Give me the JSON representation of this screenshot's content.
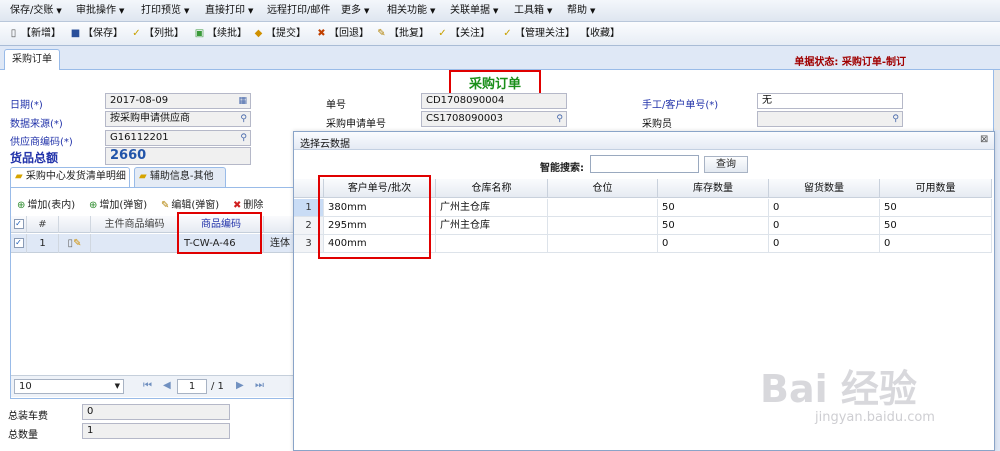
{
  "menu": [
    {
      "label": "保存/交账"
    },
    {
      "label": "审批操作"
    },
    {
      "label": "打印预览"
    },
    {
      "label": "直接打印"
    },
    {
      "label": "远程打印/邮件"
    },
    {
      "label": "更多"
    },
    {
      "label": "相关功能"
    },
    {
      "label": "关联单据"
    },
    {
      "label": "工具箱"
    },
    {
      "label": "帮助"
    }
  ],
  "toolbar": [
    {
      "label": "【新增】",
      "icon": "doc-new-icon"
    },
    {
      "label": "【保存】",
      "icon": "save-icon"
    },
    {
      "label": "【列批】",
      "icon": "check-icon"
    },
    {
      "label": "【续批】",
      "icon": "continue-icon"
    },
    {
      "label": "【提交】",
      "icon": "submit-icon"
    },
    {
      "label": "【回退】",
      "icon": "rollback-icon"
    },
    {
      "label": "【批复】",
      "icon": "reply-icon"
    },
    {
      "label": "【关注】",
      "icon": "follow-icon"
    },
    {
      "label": "【管理关注】",
      "icon": "manage-follow-icon"
    },
    {
      "label": "【收藏】",
      "icon": ""
    }
  ],
  "tab": {
    "label": "采购订单"
  },
  "status": {
    "text": "单据状态:  采购订单-制订"
  },
  "form": {
    "title": "采购订单",
    "date_label": "日期(*)",
    "date_value": "2017-08-09",
    "no_label": "单号",
    "no_value": "CD1708090004",
    "manual_label": "手工/客户单号(*)",
    "manual_value": "无",
    "source_label": "数据来源(*)",
    "source_value": "按采购申请供应商",
    "req_label": "采购申请单号",
    "req_value": "CS1708090003",
    "buyer_label": "采购员",
    "buyer_value": "",
    "supplier_label": "供应商编码(*)",
    "supplier_value": "G16112201",
    "total_label": "货品总额",
    "total_value": "2660"
  },
  "subtabs": [
    {
      "label": "采购中心发货清单明细"
    },
    {
      "label": "辅助信息-其他"
    }
  ],
  "subtoolbar": [
    {
      "label": "增加(表内)"
    },
    {
      "label": "增加(弹窗)"
    },
    {
      "label": "编辑(弹窗)"
    },
    {
      "label": "删除"
    }
  ],
  "grid": {
    "headers": {
      "num": "#",
      "main_code": "主件商品编码",
      "code": "商品编码"
    },
    "row": {
      "index": "1",
      "code": "T-CW-A-46",
      "name": "连体"
    }
  },
  "pager": {
    "size": "10",
    "page": "1",
    "of": "/ 1"
  },
  "summary": {
    "freight_label": "总装车费",
    "freight_value": "0",
    "qty_label": "总数量",
    "qty_value": "1"
  },
  "popup": {
    "title": "选择云数据",
    "smart_label": "智能搜索:",
    "query_label": "查询",
    "headers": [
      "客户单号/批次",
      "仓库名称",
      "仓位",
      "库存数量",
      "留货数量",
      "可用数量"
    ],
    "rows": [
      {
        "n": "1",
        "batch": "380mm",
        "warehouse": "广州主仓库",
        "bin": "",
        "stock": "50",
        "reserved": "0",
        "available": "50"
      },
      {
        "n": "2",
        "batch": "295mm",
        "warehouse": "广州主仓库",
        "bin": "",
        "stock": "50",
        "reserved": "0",
        "available": "50"
      },
      {
        "n": "3",
        "batch": "400mm",
        "warehouse": "",
        "bin": "",
        "stock": "0",
        "reserved": "0",
        "available": "0"
      }
    ]
  },
  "watermark": {
    "brand": "Bai 经验",
    "url": "jingyan.baidu.com"
  }
}
